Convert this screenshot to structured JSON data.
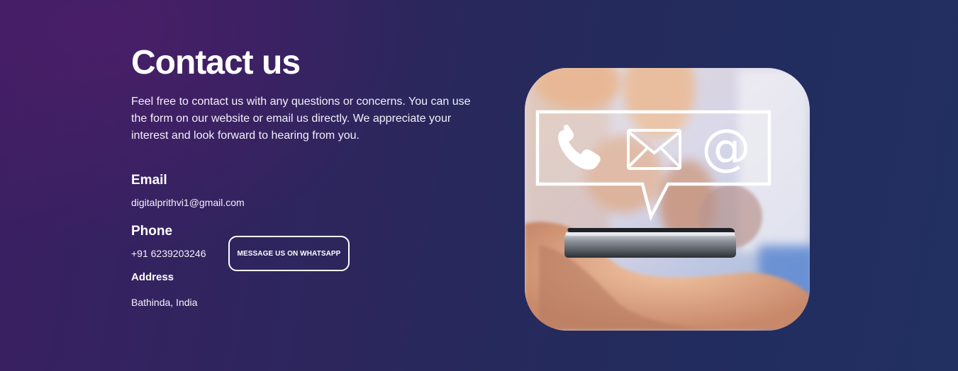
{
  "contact": {
    "title": "Contact us",
    "intro": "Feel free to contact us with any questions or concerns. You can use the form on our website or email us directly. We appreciate your interest and look forward to hearing from you.",
    "email_label": "Email",
    "email_value": "digitalprithvi1@gmail.com",
    "phone_label": "Phone",
    "phone_value": "+91 6239203246",
    "whatsapp_button": "MESSAGE US ON WHATSAPP",
    "address_label": "Address",
    "address_value": "Bathinda, India"
  },
  "image": {
    "icons": [
      "phone-icon",
      "envelope-icon",
      "at-sign-icon"
    ]
  },
  "colors": {
    "background_left": "#3b1f62",
    "background_right": "#213060",
    "text": "#ffffff"
  }
}
